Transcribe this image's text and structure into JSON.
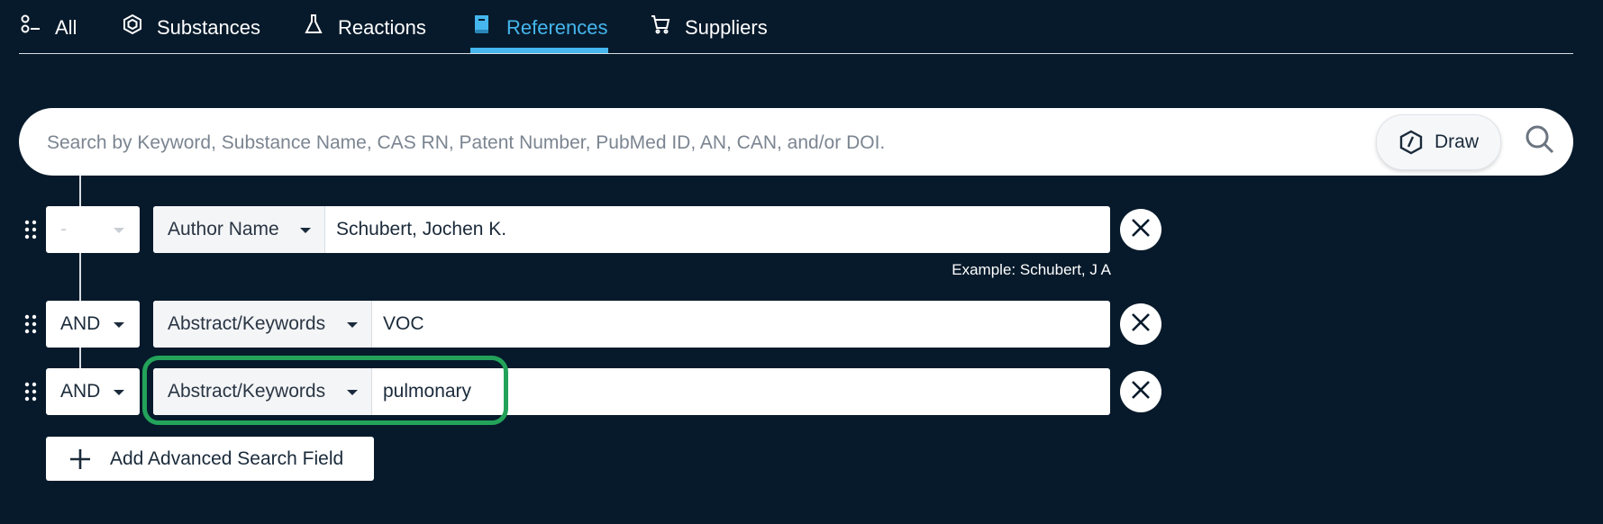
{
  "tabs": [
    {
      "label": "All",
      "icon": "all-icon",
      "active": false
    },
    {
      "label": "Substances",
      "icon": "hexagon-icon",
      "active": false
    },
    {
      "label": "Reactions",
      "icon": "flask-icon",
      "active": false
    },
    {
      "label": "References",
      "icon": "book-icon",
      "active": true
    },
    {
      "label": "Suppliers",
      "icon": "cart-icon",
      "active": false
    }
  ],
  "search": {
    "placeholder": "Search by Keyword, Substance Name, CAS RN, Patent Number, PubMed ID, AN, CAN, and/or DOI.",
    "value": "",
    "draw_label": "Draw",
    "draw_icon": "draw-hexagon-icon",
    "search_icon": "search-icon"
  },
  "advanced_fields": [
    {
      "operator": "-",
      "operator_disabled": true,
      "field": "Author Name",
      "value": "Schubert, Jochen K.",
      "example_label": "Example:",
      "example_value": "Schubert, J A"
    },
    {
      "operator": "AND",
      "operator_disabled": false,
      "field": "Abstract/Keywords",
      "value": "VOC"
    },
    {
      "operator": "AND",
      "operator_disabled": false,
      "field": "Abstract/Keywords",
      "value": "pulmonary",
      "highlighted": true
    }
  ],
  "add_field": {
    "label": "Add Advanced Search Field",
    "icon": "plus-icon"
  },
  "colors": {
    "background": "#071a2b",
    "accent": "#45b6ee",
    "highlight": "#23a35a"
  }
}
